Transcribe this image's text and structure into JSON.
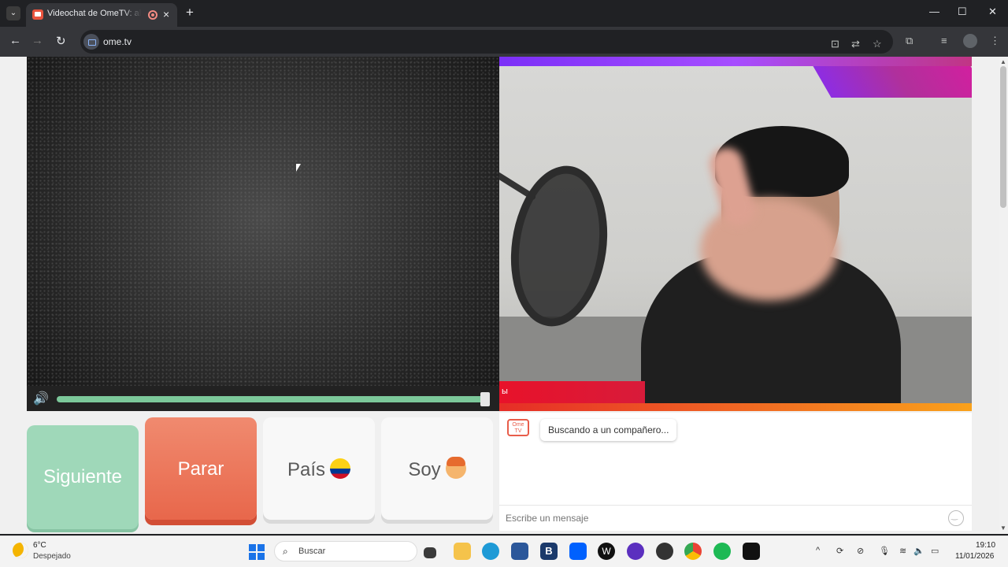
{
  "browser": {
    "tab_title": "Videochat de OmeTV: alternativa",
    "new_tab_label": "+",
    "url": "ome.tv",
    "window_controls": {
      "minimize": "—",
      "maximize": "☐",
      "close": "✕"
    }
  },
  "video": {
    "remote_status": "",
    "local_overlay_label": "ы"
  },
  "buttons": {
    "next_label": "Siguiente",
    "stop_label": "Parar",
    "country_label": "País",
    "soy_label": "Soy"
  },
  "chat": {
    "logo_text": "Ome TV",
    "status_message": "Buscando a un compañero...",
    "input_placeholder": "Escribe un mensaje"
  },
  "colors": {
    "next_button": "#9fd8b9",
    "stop_button": "#e8674b",
    "volume_track": "#7cc89a",
    "brand_purple": "#8e2de2",
    "brand_orange": "#f06623"
  },
  "taskbar": {
    "weather_temp": "6°C",
    "weather_desc": "Despejado",
    "search_placeholder": "Buscar",
    "time": "19:10",
    "date": "11/01/2026",
    "apps": [
      "file-explorer-icon",
      "folder-icon",
      "edge-icon",
      "store-icon",
      "b-app-icon",
      "dropbox-icon",
      "w-app-icon",
      "circle-app-icon",
      "record-app-icon",
      "chrome-icon",
      "spotify-icon",
      "terminal-icon"
    ]
  }
}
